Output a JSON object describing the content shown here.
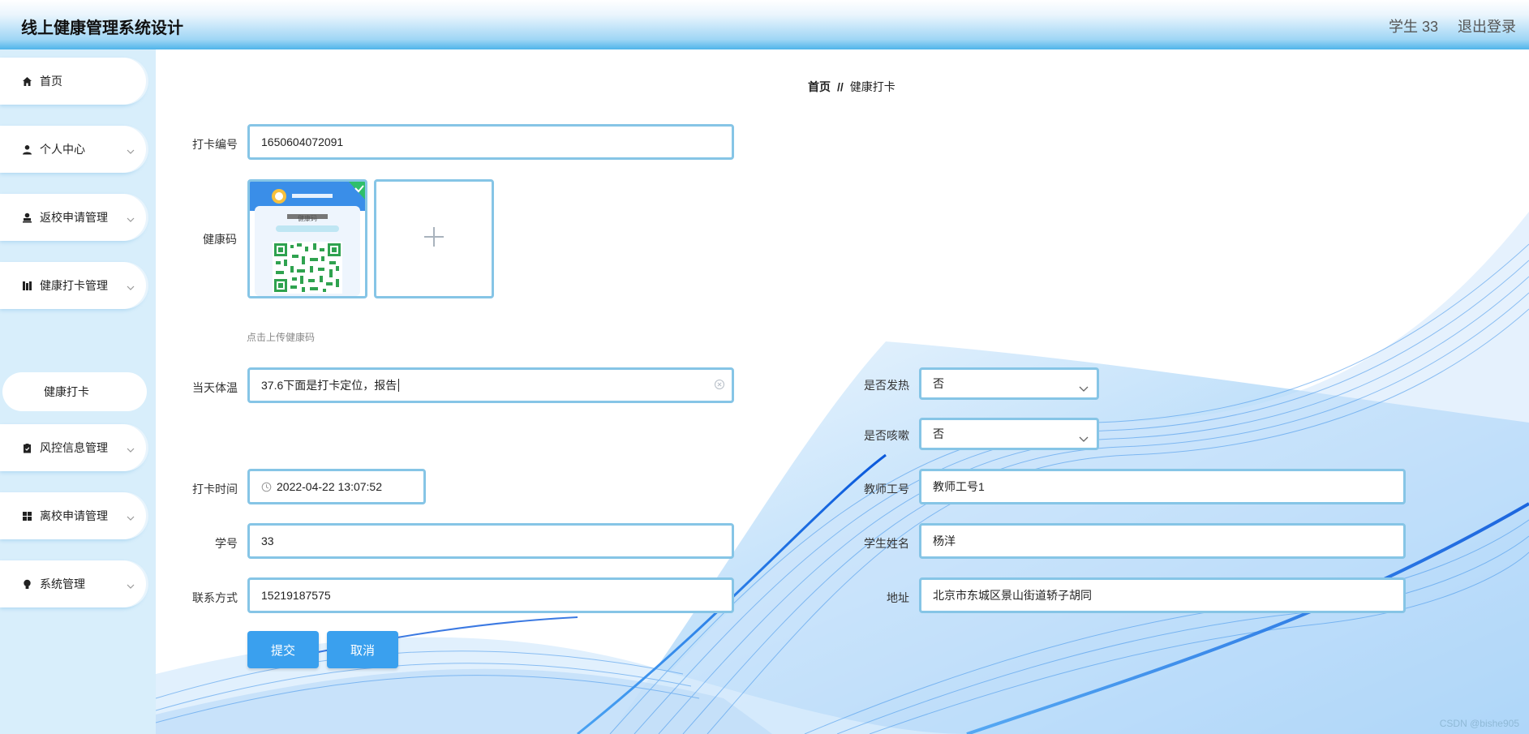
{
  "header": {
    "title": "线上健康管理系统设计",
    "user": "学生 33",
    "logout": "退出登录"
  },
  "sidebar": {
    "items": [
      {
        "label": "首页",
        "icon": "home-icon"
      },
      {
        "label": "个人中心",
        "icon": "user-icon"
      },
      {
        "label": "返校申请管理",
        "icon": "person-icon"
      },
      {
        "label": "健康打卡管理",
        "icon": "books-icon"
      },
      {
        "label": "风控信息管理",
        "icon": "clipboard-icon"
      },
      {
        "label": "离校申请管理",
        "icon": "grid-icon"
      },
      {
        "label": "系统管理",
        "icon": "bulb-icon"
      }
    ],
    "sub_item": "健康打卡"
  },
  "breadcrumb": {
    "home": "首页",
    "sep": "//",
    "current": "健康打卡"
  },
  "form": {
    "checkin_no": {
      "label": "打卡编号",
      "value": "1650604072091"
    },
    "health_code": {
      "label": "健康码",
      "hint": "点击上传健康码"
    },
    "temperature": {
      "label": "当天体温",
      "value": "37.6下面是打卡定位，报告"
    },
    "fever": {
      "label": "是否发热",
      "value": "否"
    },
    "cough": {
      "label": "是否咳嗽",
      "value": "否"
    },
    "time": {
      "label": "打卡时间",
      "value": "2022-04-22 13:07:52"
    },
    "teacher_no": {
      "label": "教师工号",
      "value": "教师工号1"
    },
    "student_no": {
      "label": "学号",
      "value": "33"
    },
    "student_name": {
      "label": "学生姓名",
      "value": "杨洋"
    },
    "contact": {
      "label": "联系方式",
      "value": "15219187575"
    },
    "address": {
      "label": "地址",
      "value": "北京市东城区景山街道轿子胡同"
    },
    "submit": "提交",
    "cancel": "取消"
  },
  "health_code_card": {
    "title": "健康码"
  },
  "watermark": "CSDN @bishe905",
  "colors": {
    "accent": "#3aa0ee",
    "input_border": "#86c5e6",
    "sidebar_bg": "#d8eefb"
  }
}
